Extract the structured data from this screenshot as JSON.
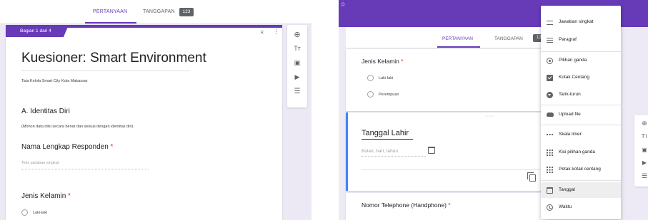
{
  "left": {
    "tabs": {
      "questions": "PERTANYAAN",
      "responses": "TANGGAPAN",
      "responses_count": "123"
    },
    "section_chip": "Bagian 1 dari 4",
    "form_title": "Kuesioner: Smart Environment",
    "form_description": "Tata Kelola Smart City Kota Makassar",
    "section_title": "A. Identitas Diri",
    "section_description": "(Mohon data diisi secara benar dan sesuai dengan identitas diri)",
    "q1": {
      "title": "Nama Lengkap Responden",
      "required": "*",
      "placeholder": "Teks jawaban singkat"
    },
    "q2": {
      "title": "Jenis Kelamin",
      "required": "*",
      "options": [
        "Laki-laki"
      ]
    },
    "sidebar_icons": [
      "add-question-icon",
      "add-title-icon",
      "add-image-icon",
      "add-video-icon",
      "add-section-icon"
    ]
  },
  "right": {
    "tabs": {
      "questions": "PERTANYAAN",
      "responses": "TANGGAPAN",
      "responses_count": "123"
    },
    "q_gender": {
      "title": "Jenis Kelamin",
      "required": "*",
      "options": [
        "Laki-laki",
        "Perempuan"
      ]
    },
    "q_birthdate": {
      "title": "Tanggal Lahir",
      "placeholder": "Bulan, hari, tahun"
    },
    "q_phone": {
      "title": "Nomor Telephone (Handphone)",
      "required": "*"
    },
    "menu": [
      {
        "label": "Jawaban singkat",
        "icon": "short-answer-icon"
      },
      {
        "label": "Paragraf",
        "icon": "paragraph-icon"
      },
      {
        "label": "Pilihan ganda",
        "icon": "radio-icon"
      },
      {
        "label": "Kotak Centang",
        "icon": "checkbox-icon"
      },
      {
        "label": "Tarik-turun",
        "icon": "dropdown-icon"
      },
      {
        "label": "Upload file",
        "icon": "upload-icon"
      },
      {
        "label": "Skala linier",
        "icon": "linear-scale-icon"
      },
      {
        "label": "Kisi pilihan ganda",
        "icon": "grid-icon"
      },
      {
        "label": "Petak kotak centang",
        "icon": "checkbox-grid-icon"
      },
      {
        "label": "Tanggal",
        "icon": "date-icon",
        "selected": true
      },
      {
        "label": "Waktu",
        "icon": "time-icon"
      }
    ]
  },
  "colors": {
    "accent": "#673ab7",
    "active_question": "#4285f4",
    "required": "#d93025"
  }
}
